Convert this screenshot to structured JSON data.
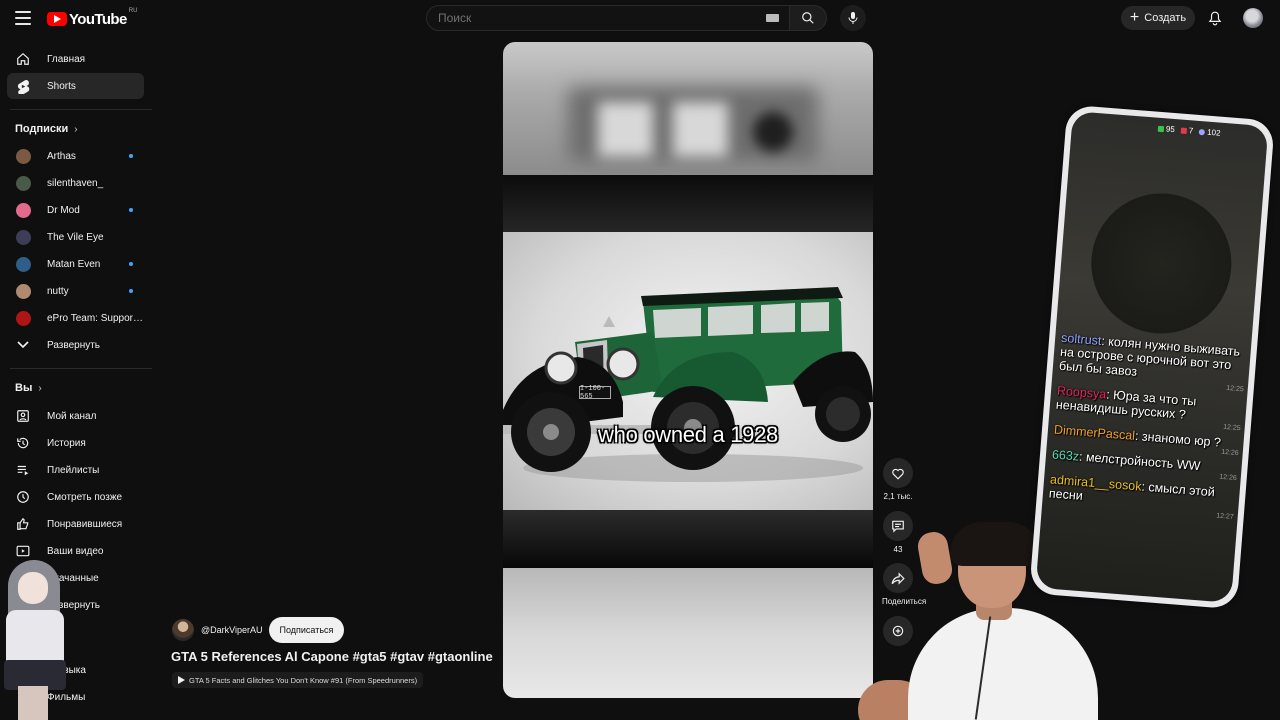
{
  "header": {
    "logo_text": "YouTube",
    "logo_region": "RU",
    "search_placeholder": "Поиск",
    "create_label": "Создать"
  },
  "sidebar": {
    "main": [
      {
        "label": "Главная",
        "icon": "home-icon"
      },
      {
        "label": "Shorts",
        "icon": "shorts-icon",
        "active": true
      }
    ],
    "subscriptions_title": "Подписки",
    "subscriptions": [
      {
        "label": "Arthas",
        "new": true,
        "color": "#7b5a43"
      },
      {
        "label": "silenthaven_",
        "new": false,
        "color": "#4a5a4a"
      },
      {
        "label": "Dr Mod",
        "new": true,
        "color": "#e26a8a"
      },
      {
        "label": "The Vile Eye",
        "new": false,
        "color": "#3d3d58"
      },
      {
        "label": "Matan Even",
        "new": true,
        "color": "#2f5f88"
      },
      {
        "label": "nutty",
        "new": true,
        "color": "#b08a70"
      },
      {
        "label": "ePro Team: Suppor…",
        "new": false,
        "color": "#b01515"
      }
    ],
    "expand_label": "Развернуть",
    "you_title": "Вы",
    "you": [
      {
        "label": "Мой канал",
        "icon": "channel-icon"
      },
      {
        "label": "История",
        "icon": "history-icon"
      },
      {
        "label": "Плейлисты",
        "icon": "playlists-icon"
      },
      {
        "label": "Смотреть позже",
        "icon": "watch-later-icon"
      },
      {
        "label": "Понравившиеся",
        "icon": "liked-icon"
      },
      {
        "label": "Ваши видео",
        "icon": "your-videos-icon"
      },
      {
        "label": "Скачанные",
        "icon": "downloads-icon"
      },
      {
        "label": "Развернуть",
        "icon": "chevron-down-icon"
      }
    ],
    "explore_title": "р",
    "explore": [
      {
        "label": "узыка",
        "icon": "music-icon"
      },
      {
        "label": "Фильмы",
        "icon": "movies-icon"
      }
    ]
  },
  "short": {
    "caption": "who owned a 1928",
    "plate": "I-100-565",
    "channel": "@DarkViperAU",
    "subscribe_label": "Подписаться",
    "title": "GTA 5 References Al Capone #gta5 #gtav #gtaonline",
    "playlist": "GTA 5 Facts and Glitches You Don't Know #91 (From Speedrunners)",
    "actions": {
      "likes": "2,1 тыс.",
      "comments": "43",
      "share": "Поделиться"
    }
  },
  "overlay": {
    "status": {
      "chat_count": "95",
      "subs": "7",
      "viewers": "102"
    },
    "chat": [
      {
        "nick": "soltrust",
        "color": "#8fa3ff",
        "text": "колян нужно выживать на острове с юрочной вот это был бы завоз",
        "time": "12:25"
      },
      {
        "nick": "Roopsya",
        "color": "#e0245e",
        "text": "Юра за что ты ненавидишь русских ?",
        "time": "12:25"
      },
      {
        "nick": "DimmerPascal",
        "color": "#f0a030",
        "text": "знаномо юр ?",
        "time": "12:26"
      },
      {
        "nick": "663z",
        "color": "#5ad8b4",
        "text": "мелстройность WW",
        "time": "12:26"
      },
      {
        "nick": "admira1__sosok",
        "color": "#e8c020",
        "text": "смысл этой песни",
        "time": "12:27"
      }
    ]
  }
}
